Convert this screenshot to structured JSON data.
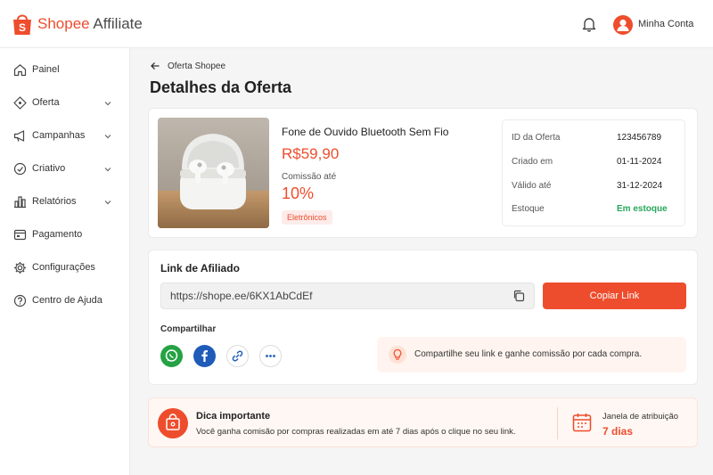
{
  "brand": {
    "name_primary": "Shopee",
    "name_secondary": "Affiliate",
    "accent": "#ee4d2d"
  },
  "header": {
    "account_label": "Minha Conta",
    "notification_icon": "bell-icon",
    "avatar_icon": "user-icon"
  },
  "sidebar": {
    "items": [
      {
        "label": "Painel",
        "icon": "home-icon",
        "has_chevron": false
      },
      {
        "label": "Oferta",
        "icon": "tag-icon",
        "has_chevron": true
      },
      {
        "label": "Campanhas",
        "icon": "megaphone-icon",
        "has_chevron": true
      },
      {
        "label": "Criativo",
        "icon": "palette-icon",
        "has_chevron": true
      },
      {
        "label": "Relatórios",
        "icon": "bar-chart-icon",
        "has_chevron": true
      },
      {
        "label": "Pagamento",
        "icon": "wallet-icon",
        "has_chevron": false
      },
      {
        "label": "Configurações",
        "icon": "gear-icon",
        "has_chevron": false
      },
      {
        "label": "Centro de Ajuda",
        "icon": "help-icon",
        "has_chevron": false
      }
    ]
  },
  "breadcrumb": {
    "back_label": "Oferta Shopee"
  },
  "page": {
    "title": "Detalhes da Oferta"
  },
  "product": {
    "name": "Fone de Ouvido Bluetooth Sem Fio",
    "price": "R$59,90",
    "commission_label": "Comissão até",
    "commission_value": "10%",
    "category": "Eletrônicos"
  },
  "offer_info": {
    "rows": [
      {
        "key": "ID da Oferta",
        "value": "123456789"
      },
      {
        "key": "Criado em",
        "value": "01-11-2024"
      },
      {
        "key": "Válido até",
        "value": "31-12-2024"
      },
      {
        "key": "Estoque",
        "value": "Em estoque"
      }
    ]
  },
  "affiliate": {
    "section_title": "Link de Afiliado",
    "link": "https://shope.ee/6KX1AbCdEf",
    "copy_button": "Copiar Link",
    "share_label": "Compartilhar",
    "share_icons": [
      "whatsapp-icon",
      "facebook-icon",
      "link-icon",
      "more-icon"
    ],
    "tip_text": "Compartilhe seu link e ganhe comissão por cada compra."
  },
  "tip_card": {
    "title": "Dica importante",
    "text": "Você ganha comisão por compras realizadas em até 7 dias após o clique no seu link.",
    "window_label": "Janela de atribuição",
    "window_value": "7 dias"
  },
  "colors": {
    "accent": "#ee4d2d",
    "success": "#26a65b",
    "whatsapp": "#25a244",
    "facebook": "#1f5bb8"
  }
}
